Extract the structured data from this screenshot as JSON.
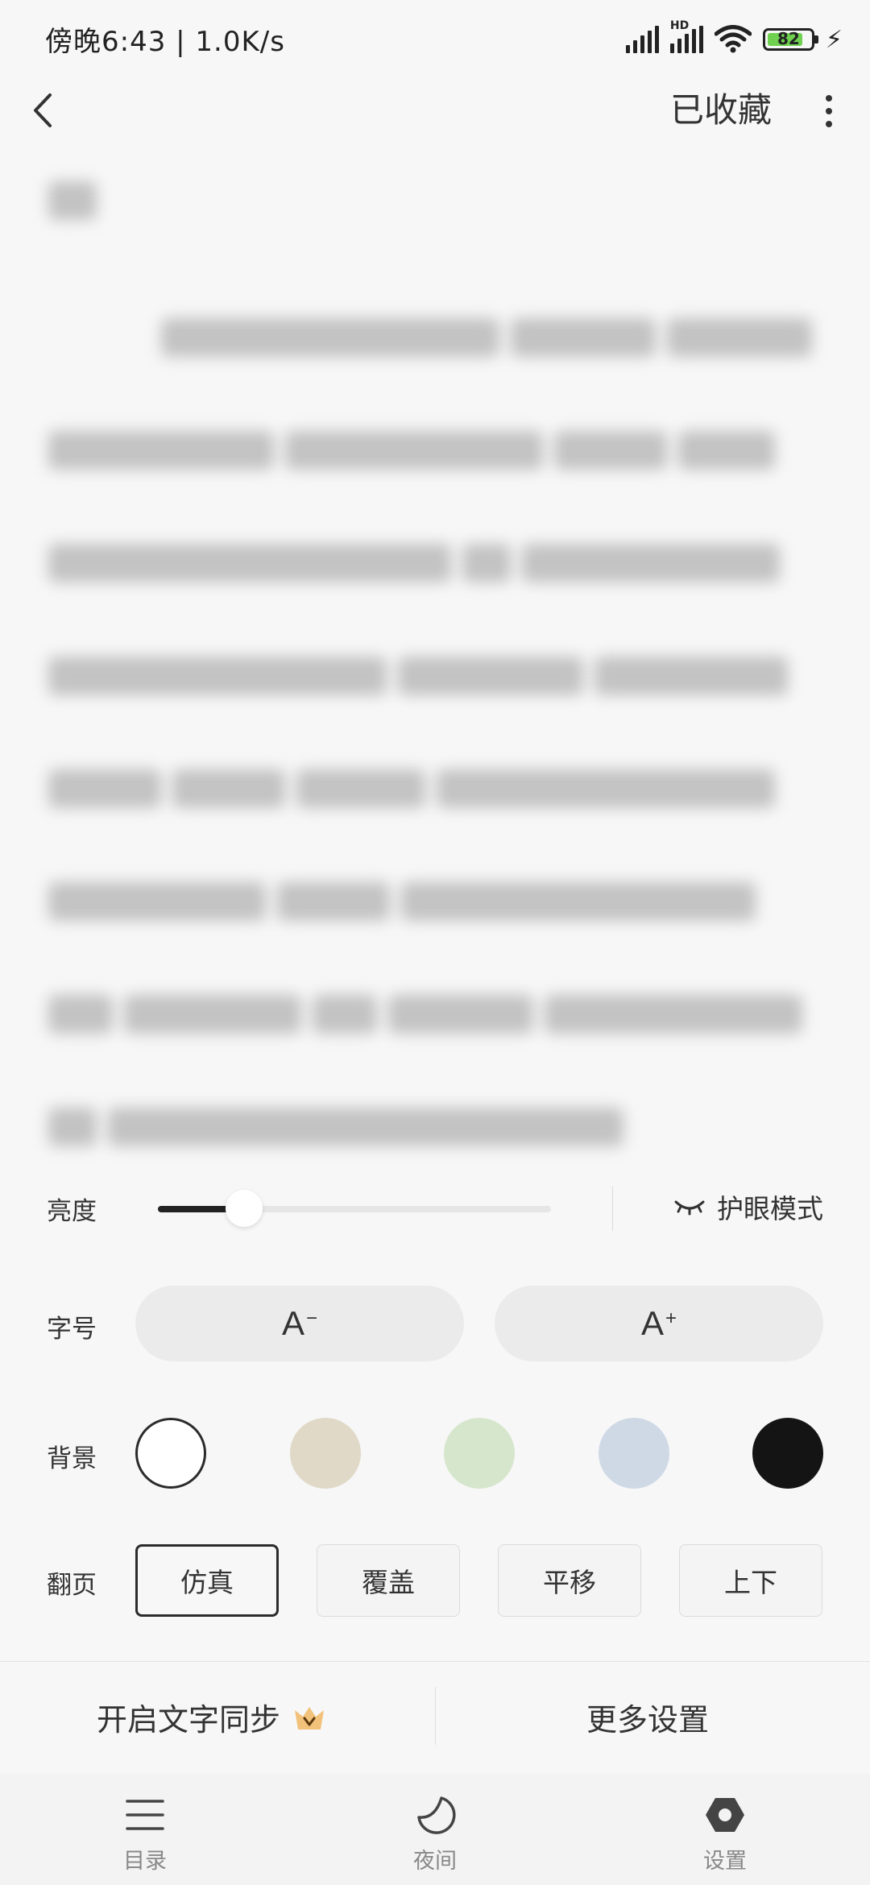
{
  "status_bar": {
    "time": "傍晚6:43 | 1.0K/s",
    "hd_label": "HD",
    "battery": "82",
    "battery_level": 0.82
  },
  "nav": {
    "back_icon": "chevron-left-icon",
    "collect_label": "已收藏",
    "more_icon": "more-vertical-icon"
  },
  "panel": {
    "brightness": {
      "label": "亮度",
      "value": 0.22
    },
    "eye_mode": {
      "label": "护眼模式",
      "icon": "closed-eye-icon"
    },
    "font_size": {
      "label": "字号",
      "decrease": "A",
      "decrease_sup": "−",
      "increase": "A",
      "increase_sup": "+"
    },
    "background": {
      "label": "背景",
      "colors": [
        "#ffffff",
        "#e0d9c8",
        "#d6e6cc",
        "#cfd9e6",
        "#141414"
      ],
      "selected": 0
    },
    "page_turn": {
      "label": "翻页",
      "options": [
        "仿真",
        "覆盖",
        "平移",
        "上下"
      ],
      "selected": 0
    }
  },
  "bottom_actions": {
    "text_sync": "开启文字同步",
    "vip_icon": "crown-icon",
    "more_settings": "更多设置"
  },
  "tabs": [
    {
      "label": "目录",
      "icon": "menu-icon"
    },
    {
      "label": "夜间",
      "icon": "moon-icon"
    },
    {
      "label": "设置",
      "icon": "settings-icon"
    }
  ],
  "colors": {
    "accent": "#222222",
    "battery_fill": "#6fd14f",
    "vip_crown": "#f2c27a"
  }
}
